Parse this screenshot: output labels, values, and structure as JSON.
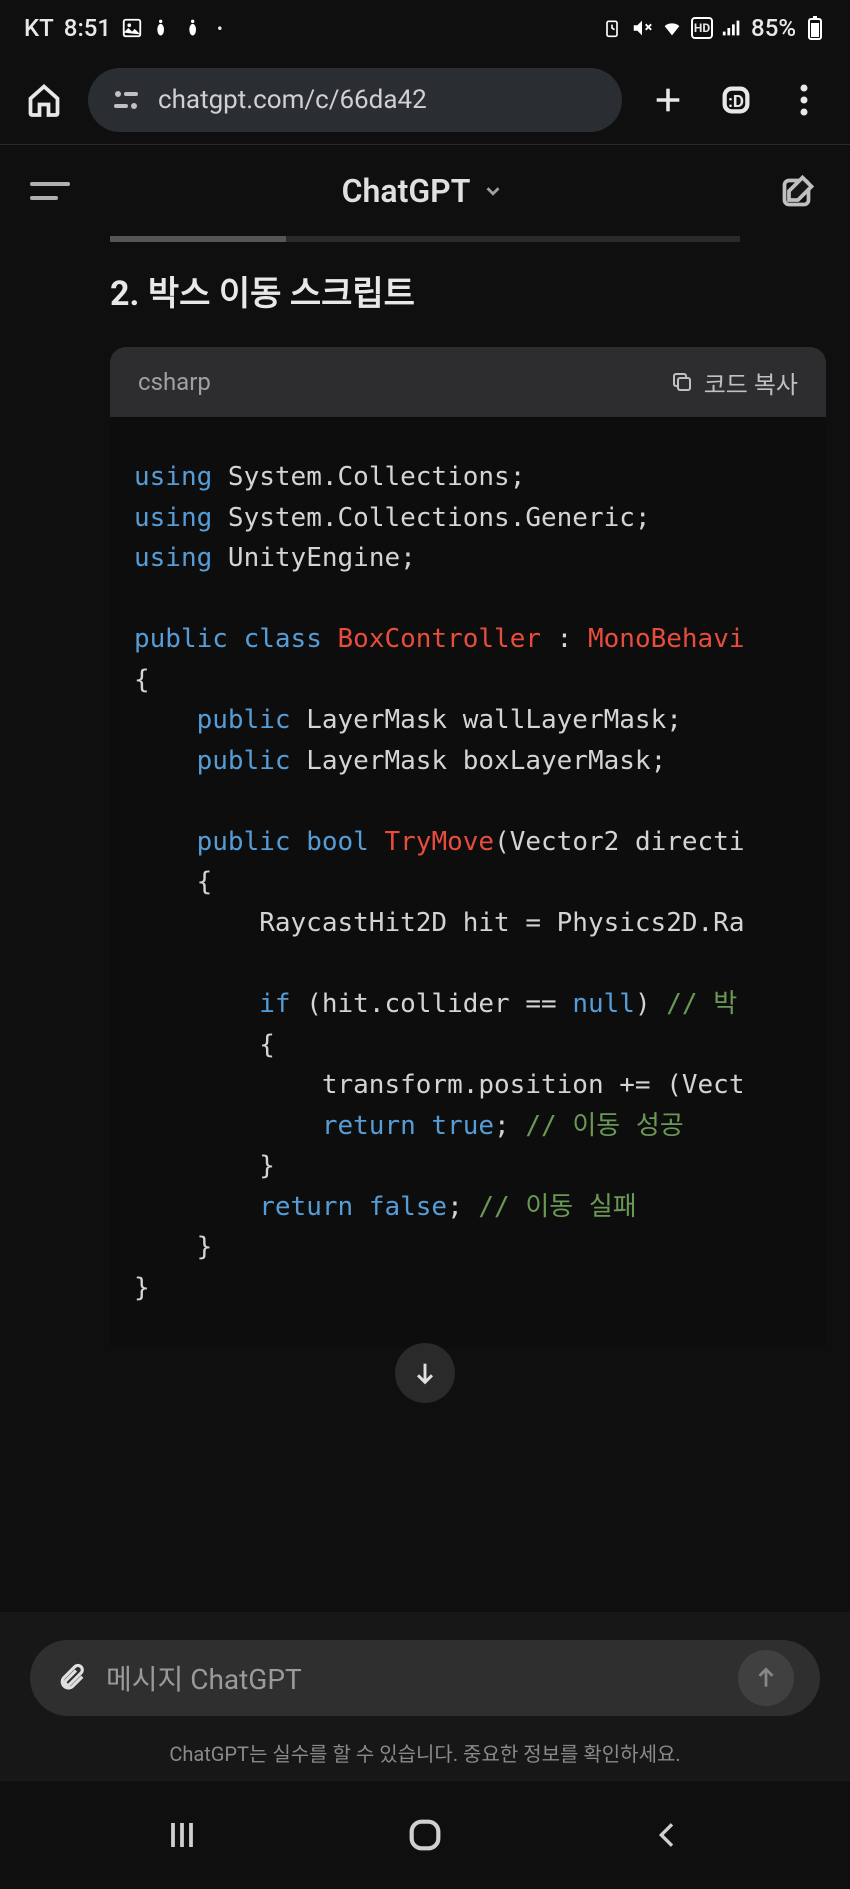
{
  "status_bar": {
    "carrier": "KT",
    "time": "8:51",
    "battery_pct": "85%"
  },
  "browser": {
    "url": "chatgpt.com/c/66da42"
  },
  "header": {
    "title": "ChatGPT"
  },
  "content": {
    "section_title": "2. 박스 이동 스크립트"
  },
  "code": {
    "language": "csharp",
    "copy_label": "코드 복사",
    "lines": [
      {
        "t": [
          {
            "c": "kw",
            "s": "using"
          },
          {
            "s": " System.Collections;"
          }
        ]
      },
      {
        "t": [
          {
            "c": "kw",
            "s": "using"
          },
          {
            "s": " System.Collections.Generic;"
          }
        ]
      },
      {
        "t": [
          {
            "c": "kw",
            "s": "using"
          },
          {
            "s": " UnityEngine;"
          }
        ]
      },
      {
        "t": [
          {
            "s": ""
          }
        ]
      },
      {
        "t": [
          {
            "c": "kw",
            "s": "public"
          },
          {
            "s": " "
          },
          {
            "c": "kw",
            "s": "class"
          },
          {
            "s": " "
          },
          {
            "c": "cls",
            "s": "BoxController"
          },
          {
            "s": " : "
          },
          {
            "c": "cls",
            "s": "MonoBehavi"
          }
        ]
      },
      {
        "t": [
          {
            "s": "{"
          }
        ]
      },
      {
        "t": [
          {
            "s": "    "
          },
          {
            "c": "kw",
            "s": "public"
          },
          {
            "s": " LayerMask wallLayerMask;"
          }
        ]
      },
      {
        "t": [
          {
            "s": "    "
          },
          {
            "c": "kw",
            "s": "public"
          },
          {
            "s": " LayerMask boxLayerMask;"
          }
        ]
      },
      {
        "t": [
          {
            "s": ""
          }
        ]
      },
      {
        "t": [
          {
            "s": "    "
          },
          {
            "c": "kw",
            "s": "public"
          },
          {
            "s": " "
          },
          {
            "c": "kw",
            "s": "bool"
          },
          {
            "s": " "
          },
          {
            "c": "mth",
            "s": "TryMove"
          },
          {
            "s": "(Vector2 directi"
          }
        ]
      },
      {
        "t": [
          {
            "s": "    {"
          }
        ]
      },
      {
        "t": [
          {
            "s": "        RaycastHit2D hit = Physics2D.Ra"
          }
        ]
      },
      {
        "t": [
          {
            "s": ""
          }
        ]
      },
      {
        "t": [
          {
            "s": "        "
          },
          {
            "c": "kw",
            "s": "if"
          },
          {
            "s": " (hit.collider == "
          },
          {
            "c": "kw",
            "s": "null"
          },
          {
            "s": ") "
          },
          {
            "c": "cmt",
            "s": "// 박"
          }
        ]
      },
      {
        "t": [
          {
            "s": "        {"
          }
        ]
      },
      {
        "t": [
          {
            "s": "            transform.position += (Vect"
          }
        ]
      },
      {
        "t": [
          {
            "s": "            "
          },
          {
            "c": "kw",
            "s": "return"
          },
          {
            "s": " "
          },
          {
            "c": "kw",
            "s": "true"
          },
          {
            "s": "; "
          },
          {
            "c": "cmt",
            "s": "// 이동 성공"
          }
        ]
      },
      {
        "t": [
          {
            "s": "        }"
          }
        ]
      },
      {
        "t": [
          {
            "s": "        "
          },
          {
            "c": "kw",
            "s": "return"
          },
          {
            "s": " "
          },
          {
            "c": "kw",
            "s": "false"
          },
          {
            "s": "; "
          },
          {
            "c": "cmt",
            "s": "// 이동 실패"
          }
        ]
      },
      {
        "t": [
          {
            "s": "    }"
          }
        ]
      },
      {
        "t": [
          {
            "s": "}"
          }
        ]
      }
    ]
  },
  "input": {
    "placeholder": "메시지 ChatGPT"
  },
  "footer": {
    "disclaimer": "ChatGPT는 실수를 할 수 있습니다. 중요한 정보를 확인하세요."
  }
}
